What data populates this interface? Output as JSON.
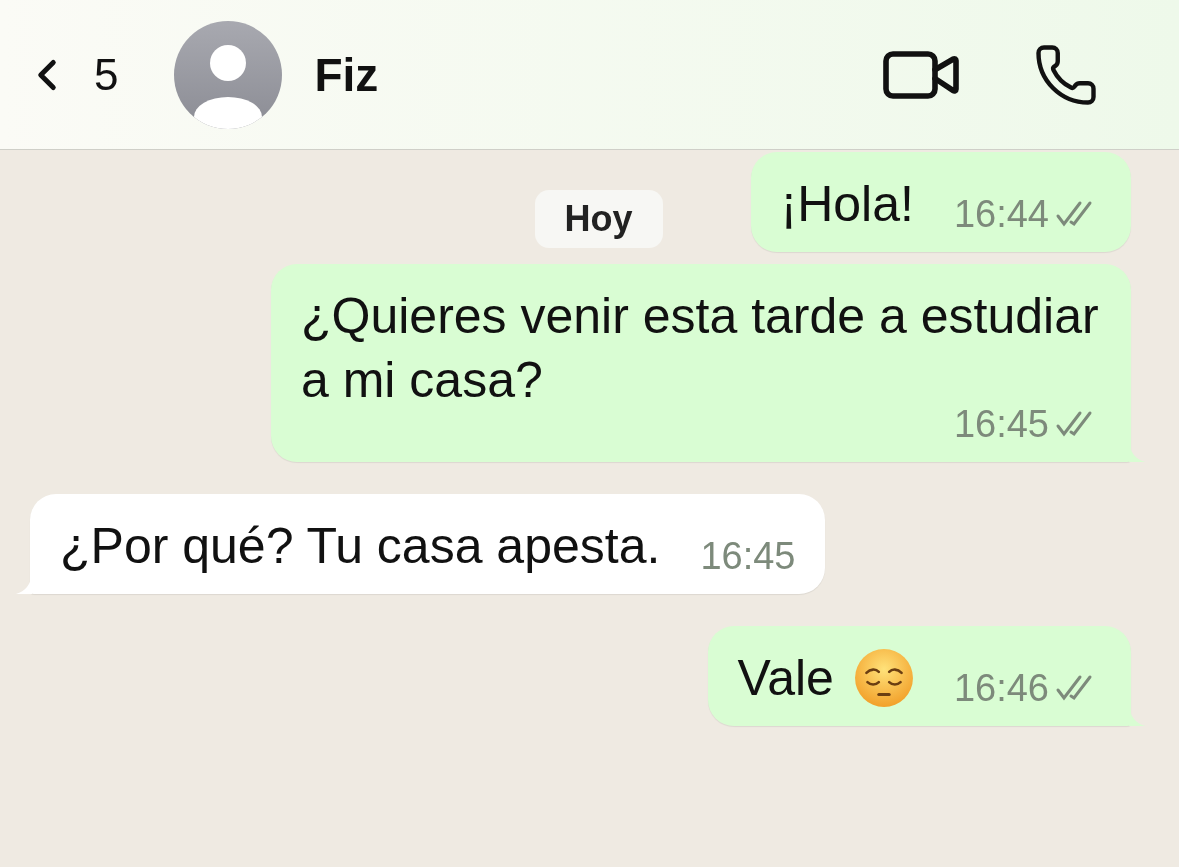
{
  "header": {
    "back_count": "5",
    "contact_name": "Fiz"
  },
  "date_label": "Hoy",
  "messages": [
    {
      "kind": "outgoing",
      "text": "¡Hola!",
      "time": "16:44",
      "read": false,
      "tail": false
    },
    {
      "kind": "outgoing",
      "text": "¿Quieres venir esta tarde a estudiar a mi casa?",
      "time": "16:45",
      "read": false,
      "tail": true
    },
    {
      "kind": "incoming",
      "text": "¿Por qué? Tu casa apesta.",
      "time": "16:45",
      "tail": true
    },
    {
      "kind": "outgoing",
      "text": "Vale",
      "emoji": true,
      "time": "16:46",
      "read": false,
      "tail": true
    }
  ]
}
